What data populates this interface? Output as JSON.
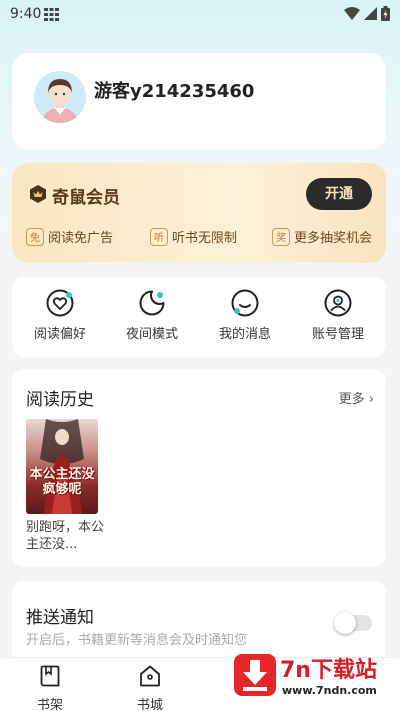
{
  "status_bar": {
    "time": "9:40"
  },
  "profile": {
    "username": "游客y214235460"
  },
  "vip": {
    "title": "奇鼠会员",
    "button_label": "开通",
    "benefits": [
      {
        "badge": "免",
        "label": "阅读免广告"
      },
      {
        "badge": "听",
        "label": "听书无限制"
      },
      {
        "badge": "奖",
        "label": "更多抽奖机会"
      }
    ]
  },
  "actions": [
    {
      "label": "阅读偏好",
      "icon": "heart-icon"
    },
    {
      "label": "夜间模式",
      "icon": "moon-icon"
    },
    {
      "label": "我的消息",
      "icon": "message-icon"
    },
    {
      "label": "账号管理",
      "icon": "account-icon"
    }
  ],
  "history": {
    "title": "阅读历史",
    "more_label": "更多",
    "books": [
      {
        "cover_title": "本公主还没疯够呢",
        "name": "别跑呀，本公主还没..."
      }
    ]
  },
  "push": {
    "title": "推送通知",
    "description": "开启后，书籍更新等消息会及时通知您",
    "enabled": false
  },
  "bottom_nav": [
    {
      "label": "书架",
      "icon": "bookshelf-icon"
    },
    {
      "label": "书城",
      "icon": "bookstore-icon"
    }
  ],
  "watermark": {
    "title": "7n下载站",
    "url": "www.7ndn.com"
  },
  "colors": {
    "accent": "#2b2b2b",
    "vip_gold": "#c99a5a",
    "watermark_red": "#e8262a"
  }
}
